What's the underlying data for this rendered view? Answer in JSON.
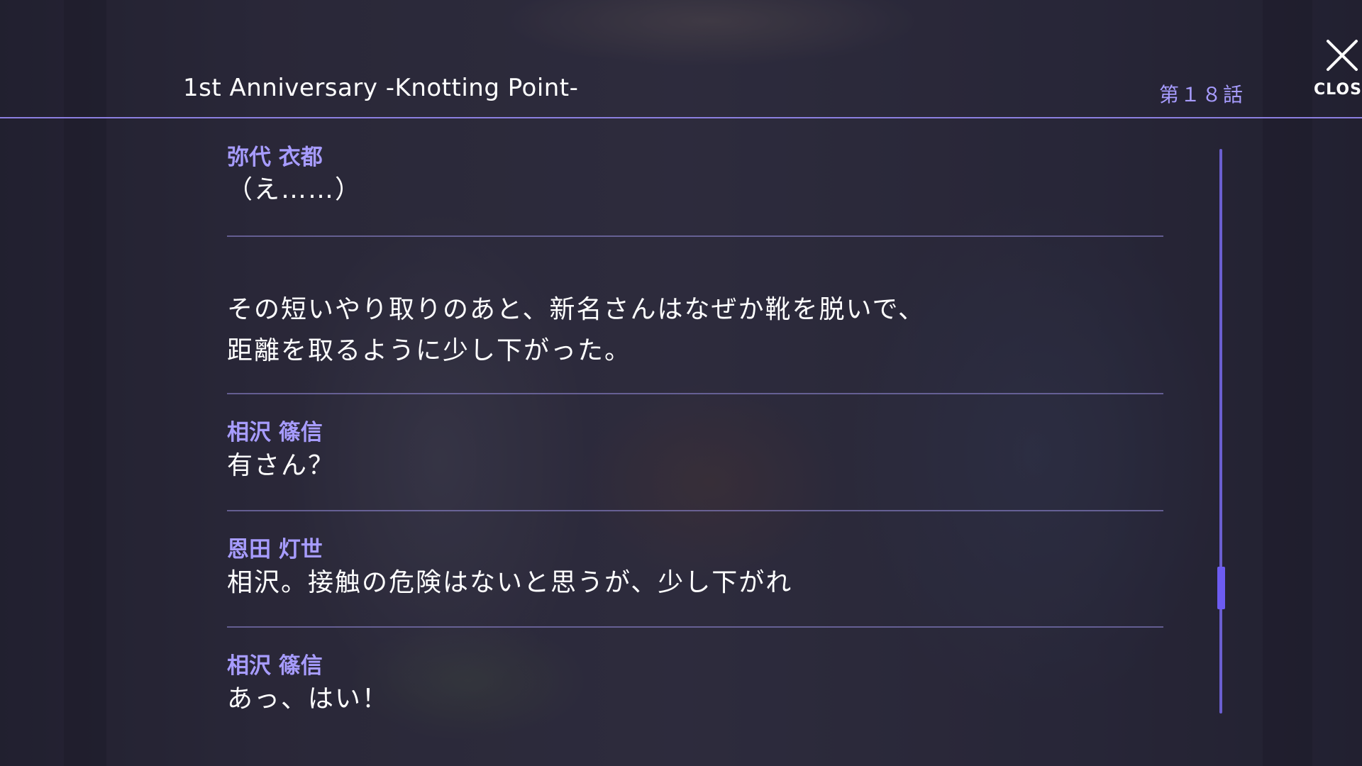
{
  "header": {
    "title": "1st Anniversary  -Knotting Point-",
    "episode": "第１８話",
    "close_label": "CLOS"
  },
  "log": [
    {
      "speaker": "弥代 衣都",
      "text": [
        "（え……）"
      ]
    },
    {
      "speaker": "",
      "text": [
        "その短いやり取りのあと、新名さんはなぜか靴を脱いで、",
        "距離を取るように少し下がった。"
      ]
    },
    {
      "speaker": "相沢 篠信",
      "text": [
        "有さん？"
      ]
    },
    {
      "speaker": "恩田 灯世",
      "text": [
        "相沢。接触の危険はないと思うが、少し下がれ"
      ]
    },
    {
      "speaker": "相沢 篠信",
      "text": [
        "あっ、はい！"
      ]
    }
  ],
  "scroll": {
    "position_fraction": 0.8
  },
  "colors": {
    "accent": "#a79cff",
    "divider": "#8c7fe0",
    "scroll_thumb": "#6d5cf2"
  },
  "icons": {
    "close": "close-icon"
  }
}
